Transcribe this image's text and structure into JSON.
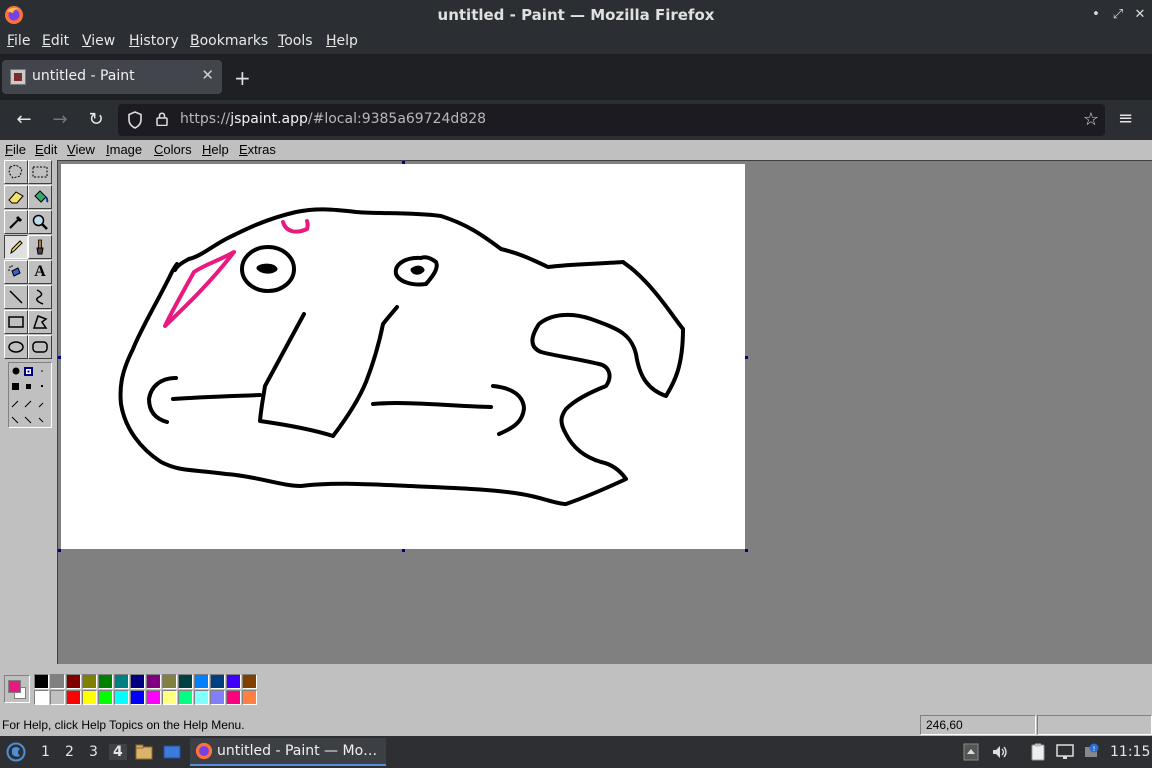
{
  "window": {
    "title": "untitled - Paint — Mozilla Firefox",
    "controls": {
      "minimize": "•",
      "maximize": "⤢",
      "close": "✕"
    }
  },
  "browser_menu": [
    "File",
    "Edit",
    "View",
    "History",
    "Bookmarks",
    "Tools",
    "Help"
  ],
  "tab": {
    "label": "untitled - Paint",
    "close": "✕",
    "new_tab": "+"
  },
  "navigation": {
    "back": "←",
    "forward": "→",
    "reload": "↻",
    "url_prefix": "https://",
    "url_host": "jspaint.app",
    "url_rest": "/#local:9385a69724d828",
    "bookmark": "☆",
    "menu": "≡"
  },
  "paint_menu": [
    "File",
    "Edit",
    "View",
    "Image",
    "Colors",
    "Help",
    "Extras"
  ],
  "tools": {
    "text_tool_glyph": "A",
    "active_tool": "pencil"
  },
  "palette": {
    "foreground": "#e8197f",
    "background": "#ffffff",
    "colors_row1": [
      "#000000",
      "#808080",
      "#800000",
      "#808000",
      "#008000",
      "#008080",
      "#000080",
      "#800080",
      "#808040",
      "#004040",
      "#0080ff",
      "#004080",
      "#4000ff",
      "#804000"
    ],
    "colors_row2": [
      "#ffffff",
      "#c0c0c0",
      "#ff0000",
      "#ffff00",
      "#00ff00",
      "#00ffff",
      "#0000ff",
      "#ff00ff",
      "#ffff80",
      "#00ff80",
      "#80ffff",
      "#8080ff",
      "#ff0080",
      "#ff8040"
    ]
  },
  "status": {
    "help_text": "For Help, click Help Topics on the Help Menu.",
    "coordinates": "246,60",
    "size": ""
  },
  "taskbar": {
    "workspaces": [
      "1",
      "2",
      "3",
      "4"
    ],
    "active_workspace": "4",
    "task_label": "untitled - Paint — Mo…",
    "clock": "11:15"
  },
  "colors": {
    "stroke_black": "#000000",
    "stroke_pink": "#e8197f",
    "accent": "#5a8dd8"
  }
}
